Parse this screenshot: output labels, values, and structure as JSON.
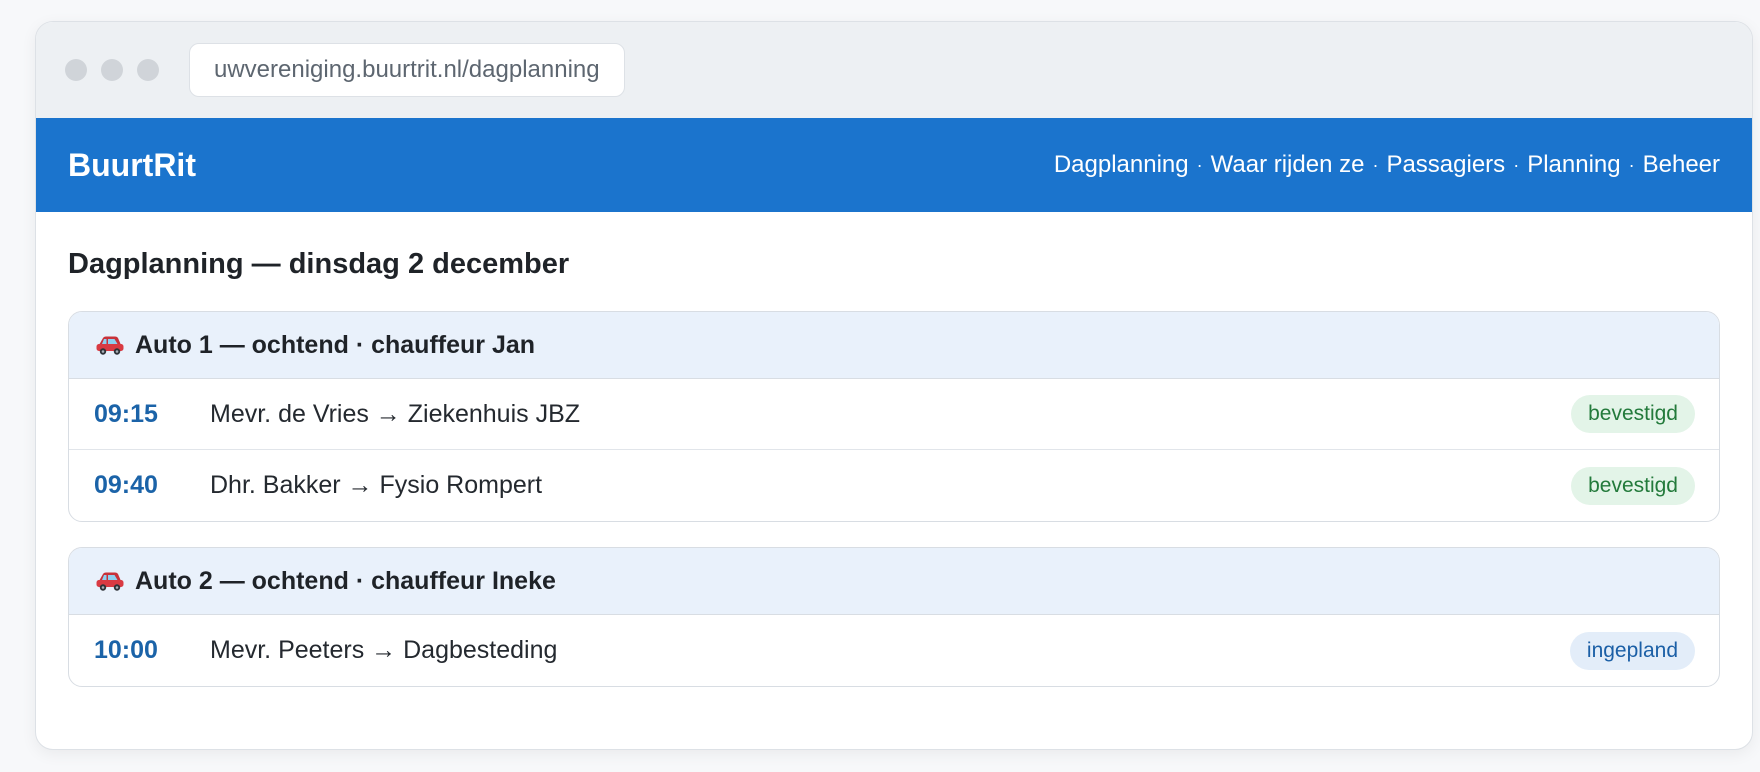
{
  "browser": {
    "url": "uwvereniging.buurtrit.nl/dagplanning"
  },
  "app": {
    "brand": "BuurtRit",
    "nav": [
      {
        "label": "Dagplanning"
      },
      {
        "label": "Waar rijden ze"
      },
      {
        "label": "Passagiers"
      },
      {
        "label": "Planning"
      },
      {
        "label": "Beheer"
      }
    ],
    "nav_separator": "·"
  },
  "page": {
    "title": "Dagplanning — dinsdag 2 december"
  },
  "groups": [
    {
      "icon": "car-icon",
      "title": "Auto 1 — ochtend · chauffeur Jan",
      "rides": [
        {
          "time": "09:15",
          "description": "Mevr. de Vries → Ziekenhuis JBZ",
          "status": "bevestigd",
          "status_type": "confirmed"
        },
        {
          "time": "09:40",
          "description": "Dhr. Bakker → Fysio Rompert",
          "status": "bevestigd",
          "status_type": "confirmed"
        }
      ]
    },
    {
      "icon": "car-icon",
      "title": "Auto 2 — ochtend · chauffeur Ineke",
      "rides": [
        {
          "time": "10:00",
          "description": "Mevr. Peeters → Dagbesteding",
          "status": "ingepland",
          "status_type": "planned"
        }
      ]
    }
  ],
  "colors": {
    "appbar": "#1b74cd",
    "group_header": "#e9f1fb",
    "time": "#1b63a8",
    "confirmed_bg": "#e3f4e8",
    "confirmed_text": "#237a3b",
    "planned_bg": "#e3edf9",
    "planned_text": "#1b5fa6"
  }
}
